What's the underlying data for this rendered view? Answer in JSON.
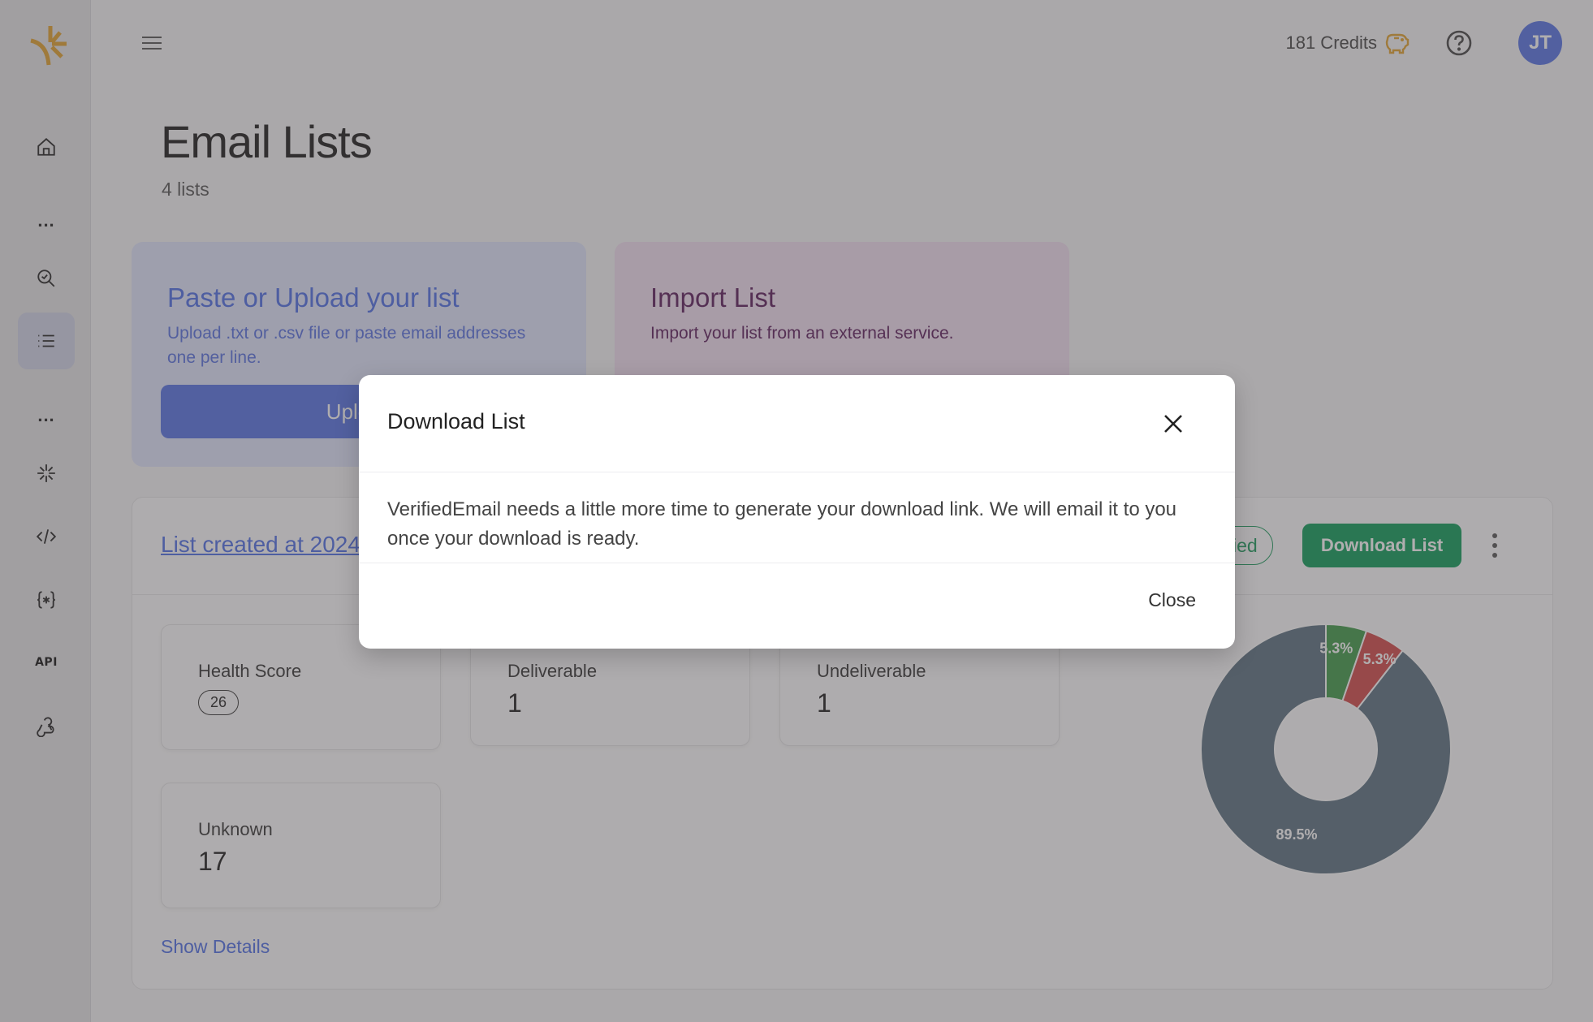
{
  "brand": {
    "accent": "#e0a12d",
    "primary": "#5472e4",
    "success": "#0b9b58"
  },
  "sidebar": {
    "items": [
      {
        "name": "home",
        "icon": "home-icon"
      },
      {
        "name": "more-1",
        "icon": "ellipsis-icon",
        "label": "..."
      },
      {
        "name": "verify",
        "icon": "search-check-icon"
      },
      {
        "name": "lists",
        "icon": "list-icon",
        "active": true
      },
      {
        "name": "more-2",
        "icon": "ellipsis-icon",
        "label": "..."
      },
      {
        "name": "sparkle",
        "icon": "sparkle-icon"
      },
      {
        "name": "code",
        "icon": "code-icon"
      },
      {
        "name": "regex",
        "icon": "braces-asterisk-icon"
      },
      {
        "name": "api",
        "icon": "api-icon",
        "label": "API"
      },
      {
        "name": "webhooks",
        "icon": "webhook-icon"
      }
    ]
  },
  "header": {
    "credits": "181 Credits",
    "avatar_initials": "JT"
  },
  "page": {
    "title": "Email Lists",
    "subtitle": "4 lists"
  },
  "actions": {
    "upload": {
      "title": "Paste or Upload your list",
      "description": "Upload .txt or .csv file or paste email addresses one per line.",
      "button": "Upload"
    },
    "import": {
      "title": "Import List",
      "description": "Import your list from an external service."
    }
  },
  "list": {
    "title": "List created at 2024",
    "status": "Verified",
    "download_label": "Download List",
    "stats": [
      {
        "label": "Health Score",
        "value": "26",
        "badge": true
      },
      {
        "label": "Deliverable",
        "value": "1"
      },
      {
        "label": "Undeliverable",
        "value": "1"
      },
      {
        "label": "Unknown",
        "value": "17"
      }
    ],
    "show_details": "Show Details"
  },
  "chart_data": {
    "type": "pie",
    "donut": true,
    "categories": [
      "Deliverable",
      "Undeliverable",
      "Unknown"
    ],
    "values": [
      1,
      1,
      17
    ],
    "labels": [
      "5.3%",
      "5.3%",
      "89.5%"
    ],
    "colors": [
      "#3f9a48",
      "#d24848",
      "#5a6f80"
    ]
  },
  "modal": {
    "title": "Download List",
    "message": "VerifiedEmail needs a little more time to generate your download link. We will email it to you once your download is ready.",
    "close_label": "Close"
  }
}
